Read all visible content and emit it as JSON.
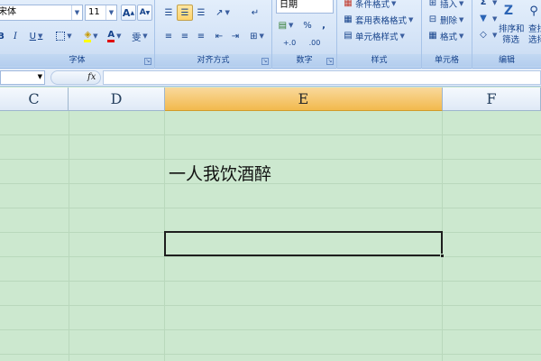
{
  "ribbon": {
    "font_group": {
      "label": "字体",
      "font_name_partial": "宋体",
      "font_size": "11",
      "grow_font": "A",
      "shrink_font": "A",
      "bold": "B",
      "italic": "I",
      "underline": "U",
      "font_color_glyph": "A",
      "fill_color_glyph": "◈",
      "phonetic_glyph": "雯"
    },
    "align_group": {
      "label": "对齐方式"
    },
    "number_group": {
      "label": "数字",
      "format_value": "日期",
      "percent": "%",
      "comma": ",",
      "increase_decimal": "+.0",
      "decrease_decimal": ".00"
    },
    "styles_group": {
      "label": "样式",
      "conditional_format": "条件格式",
      "table_format": "套用表格格式",
      "cell_styles": "单元格样式"
    },
    "cells_group": {
      "label": "单元格",
      "insert": "插入",
      "delete": "删除",
      "format": "格式"
    },
    "edit_group": {
      "label": "编辑",
      "sort_filter": "排序和\n筛选",
      "sort_filter_line1": "排序和",
      "sort_filter_line2": "筛选",
      "find_line1": "查找",
      "find_line2": "选择"
    }
  },
  "formula_bar": {
    "name_box_value": "",
    "fx_label": "fx",
    "formula_value": ""
  },
  "columns": [
    {
      "letter": "C",
      "active": false
    },
    {
      "letter": "D",
      "active": false
    },
    {
      "letter": "E",
      "active": true
    },
    {
      "letter": "F",
      "active": false
    }
  ],
  "cells": {
    "E_text": "一人我饮酒醉"
  },
  "colors": {
    "grid_background": "#cce8cf",
    "active_header": "#f2b94d",
    "ribbon": "#d5e4f7"
  }
}
